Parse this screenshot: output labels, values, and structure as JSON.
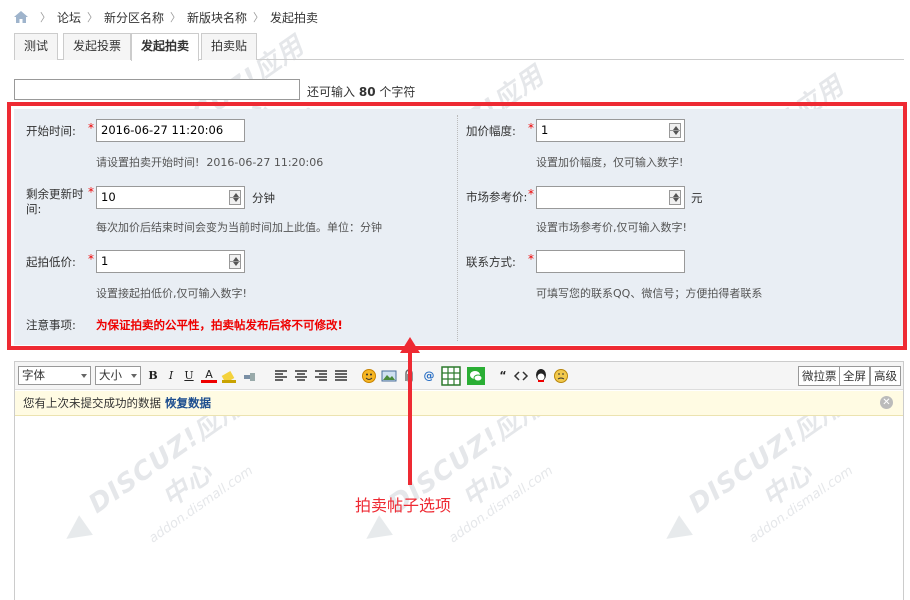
{
  "breadcrumb": {
    "items": [
      "论坛",
      "新分区名称",
      "新版块名称",
      "发起拍卖"
    ]
  },
  "tabs": [
    {
      "label": "测试",
      "active": false
    },
    {
      "label": "发起投票",
      "active": false
    },
    {
      "label": "发起拍卖",
      "active": true
    },
    {
      "label": "拍卖贴",
      "active": false
    }
  ],
  "subject": {
    "value": "",
    "hint_prefix": "还可输入",
    "hint_count": "80",
    "hint_suffix": "个字符"
  },
  "auction": {
    "start_time": {
      "label": "开始时间:",
      "value": "2016-06-27 11:20:06",
      "help_prefix": "请设置拍卖开始时间!",
      "help_value": "2016-06-27 11:20:06"
    },
    "remaining": {
      "label_line1": "剩余更新时",
      "label_line2": "间:",
      "value": "10",
      "unit": "分钟",
      "help": "每次加价后结束时间会变为当前时间加上此值。单位：分钟"
    },
    "start_price": {
      "label": "起拍低价:",
      "value": "1",
      "help": "设置接起拍低价,仅可输入数字!"
    },
    "increment": {
      "label": "加价幅度:",
      "value": "1",
      "help": "设置加价幅度，仅可输入数字!"
    },
    "market_price": {
      "label": "市场参考价:",
      "value": "",
      "unit": "元",
      "help": "设置市场参考价,仅可输入数字!"
    },
    "contact": {
      "label": "联系方式:",
      "value": "",
      "help": "可填写您的联系QQ、微信号；方便拍得者联系"
    },
    "notice": {
      "label": "注意事项:",
      "text": "为保证拍卖的公平性，拍卖帖发布后将不可修改!"
    },
    "required_mark": "*"
  },
  "editor": {
    "font_select": "字体",
    "size_select": "大小",
    "buttons": {
      "bold": "B",
      "italic": "I",
      "underline": "U",
      "color": "A",
      "quote": "“"
    },
    "right_buttons": [
      "微拉票",
      "全屏",
      "高级"
    ],
    "draft_text": "您有上次未提交成功的数据",
    "draft_restore": "恢复数据"
  },
  "annotation": {
    "text": "拍卖帖子选项"
  },
  "colors": {
    "accent_red": "#ee2a33",
    "panel_bg": "#e9eef4"
  }
}
